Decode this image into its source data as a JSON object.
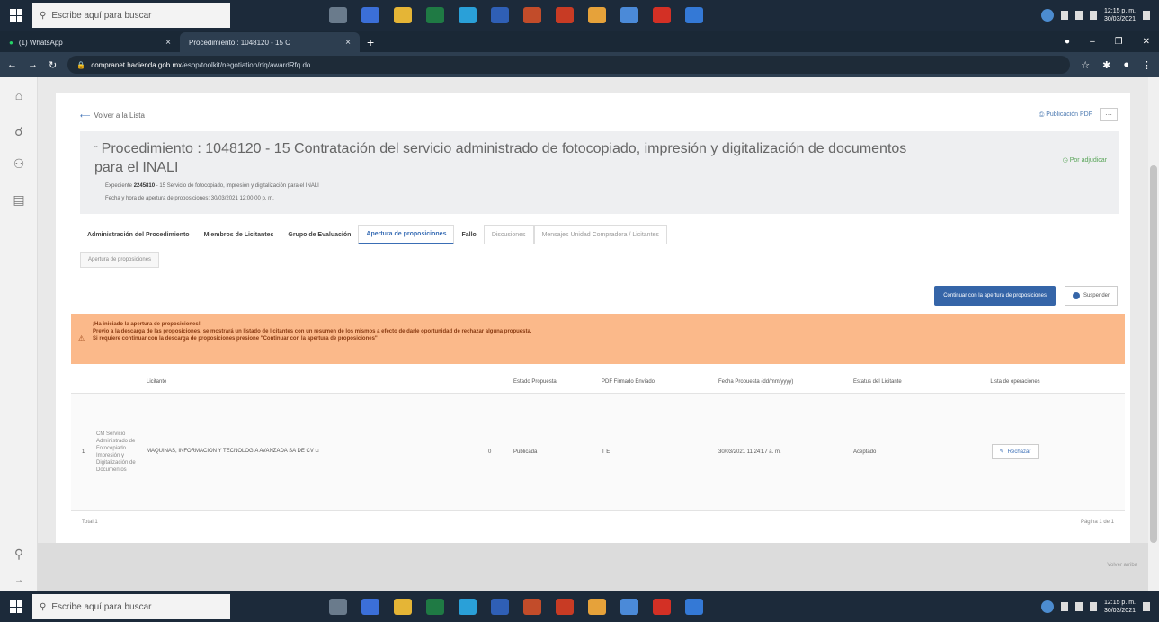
{
  "taskbar": {
    "search_placeholder": "Escribe aquí para buscar",
    "time": "12:15 p. m.",
    "date": "30/03/2021",
    "bottom_time": "12:15 p. m.",
    "bottom_date": "30/03/2021"
  },
  "browser": {
    "tabs": [
      {
        "label": "(1) WhatsApp"
      },
      {
        "label": "Procedimiento : 1048120 - 15 C"
      }
    ],
    "new_tab": "+",
    "url_host": "compranet.hacienda.gob.mx",
    "url_path": "/esop/toolkit/negotiation/rfq/awardRfq.do"
  },
  "page": {
    "back_link": "Volver a la Lista",
    "pdf_publication": "Publicación PDF",
    "more": "···",
    "procedure_title": "Procedimiento : 1048120 - 15 Contratación del servicio administrado de fotocopiado, impresión y digitalización de documentos para el INALI",
    "status": "Por adjudicar",
    "expediente_label": "Expediente",
    "expediente_number": "2245810",
    "expediente_desc": "- 15 Servicio de fotocopiado, impresión y digitalización para el INALI",
    "opening_label": "Fecha y hora de apertura de proposiciones:",
    "opening_value": "30/03/2021 12:00:00 p. m.",
    "tabs": [
      "Administración del Procedimiento",
      "Miembros de Licitantes",
      "Grupo de Evaluación",
      "Apertura de proposiciones",
      "Fallo",
      "Discusiones",
      "Mensajes Unidad Compradora / Licitantes"
    ],
    "subtab": "Apertura de proposiciones",
    "continue_button": "Continuar con la apertura de proposiciones",
    "suspend_button": "Suspender",
    "alert_title": "¡Ha iniciado la apertura de proposiciones!",
    "alert_line1": "Previo a la descarga de las proposiciones, se mostrará un listado de licitantes con un resumen de los mismos a efecto de darle oportunidad de rechazar alguna propuesta.",
    "alert_line2": "Si requiere continuar con la descarga de proposiciones presione \"Continuar con la apertura de proposiciones\"",
    "table": {
      "headers": [
        "Licitante",
        "Estado Propuesta",
        "PDF Firmado Enviado",
        "Fecha Propuesta (dd/mm/yyyy)",
        "Estatus del Licitante",
        "Lista de operaciones"
      ],
      "rows": [
        {
          "index": "1",
          "image_alt": "CM Servicio Administrado de Fotocopiado Impresión y Digitalización de Documentos",
          "bidder": "MAQUINAS, INFORMACION Y TECNOLOGIA AVANZADA SA DE CV",
          "count": "0",
          "state": "Publicada",
          "pdf": "T E",
          "date": "30/03/2021 11:24:17 a. m.",
          "bidder_status": "Aceptado",
          "action": "Rechazar"
        }
      ],
      "total": "Total 1",
      "pages": "Página 1 de 1"
    },
    "footer_right": "Volver arriba"
  }
}
